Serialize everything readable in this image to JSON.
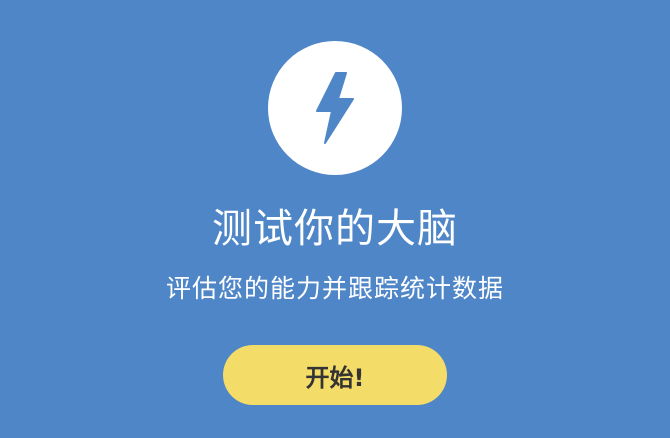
{
  "screen": {
    "title": "测试你的大脑",
    "subtitle": "评估您的能力并跟踪统计数据",
    "icon": "lightning-bolt-icon",
    "start_button_label": "开始!"
  },
  "colors": {
    "background": "#4f86c8",
    "icon_circle": "#ffffff",
    "icon": "#4f86c8",
    "title_text": "#ffffff",
    "button": "#f4dc69",
    "button_text": "#333333"
  }
}
